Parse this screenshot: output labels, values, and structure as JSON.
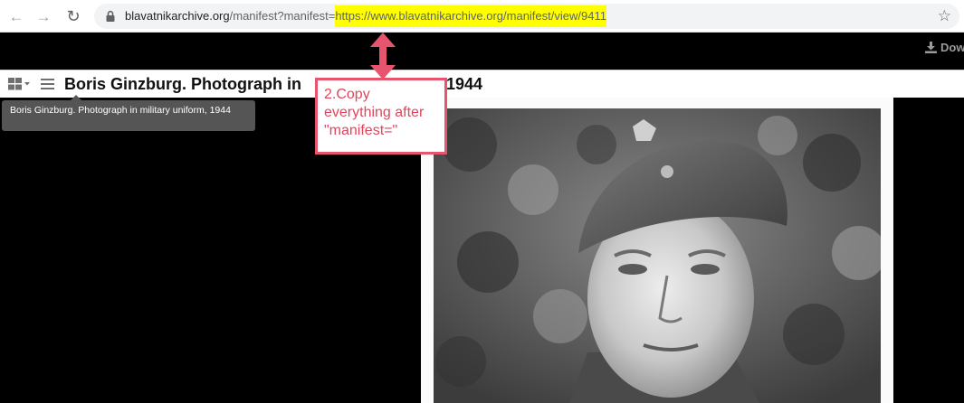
{
  "browser": {
    "back_icon": "arrow-left-icon",
    "forward_icon": "arrow-right-icon",
    "reload_icon": "reload-icon",
    "lock_icon": "lock-icon",
    "star_icon": "star-icon",
    "url_host": "blavatnikarchive.org",
    "url_path": "/manifest?manifest=",
    "url_highlighted": "https://www.blavatnikarchive.org/manifest/view/9411",
    "highlight_color": "#ffff00"
  },
  "viewer": {
    "download_label": "Dow",
    "download_icon": "download-icon",
    "grid_icon": "grid-view-icon",
    "menu_icon": "hamburger-menu-icon",
    "title": "Boris Ginzburg. Photograph in military uniform, 1944",
    "title_visible_left": "Boris Ginzburg. Photograph in",
    "title_visible_right": ", 1944",
    "tooltip": "Boris Ginzburg. Photograph in military uniform, 1944"
  },
  "annotation": {
    "text": "2.Copy everything after \"manifest=\"",
    "color": "#e6546d"
  },
  "photo": {
    "subject": "portrait of a soldier in military cap"
  }
}
